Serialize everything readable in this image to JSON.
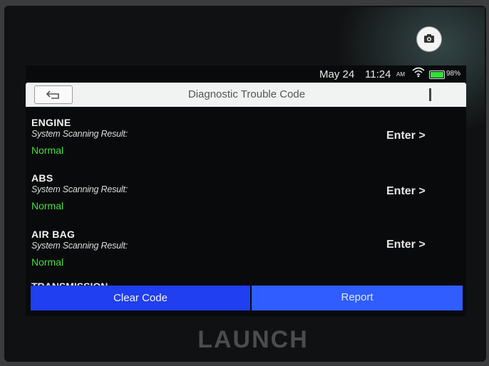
{
  "status_bar": {
    "date": "May 24",
    "time": "11:24",
    "meridiem": "AM",
    "battery_percent": "98%",
    "battery_level": 0.98,
    "wifi_icon": "wifi-icon",
    "battery_icon": "battery-icon"
  },
  "header": {
    "back_icon": "back-arrow-icon",
    "title": "Diagnostic Trouble Code",
    "camera_icon": "camera-icon"
  },
  "systems": [
    {
      "name": "ENGINE",
      "label": "System Scanning Result:",
      "status": "Normal",
      "action": "Enter >"
    },
    {
      "name": "ABS",
      "label": "System Scanning Result:",
      "status": "Normal",
      "action": "Enter >"
    },
    {
      "name": "AIR BAG",
      "label": "System Scanning Result:",
      "status": "Normal",
      "action": "Enter >"
    }
  ],
  "partial_item": "TRANSMISSION",
  "buttons": {
    "clear_code": "Clear Code",
    "report": "Report"
  },
  "device": {
    "brand": "LAUNCH"
  },
  "colors": {
    "status_ok": "#41e03a",
    "primary_button": "#1f3ff0",
    "secondary_button": "#2f5dff",
    "header_bg": "#f1f2f2",
    "screen_bg": "#090a0b"
  }
}
